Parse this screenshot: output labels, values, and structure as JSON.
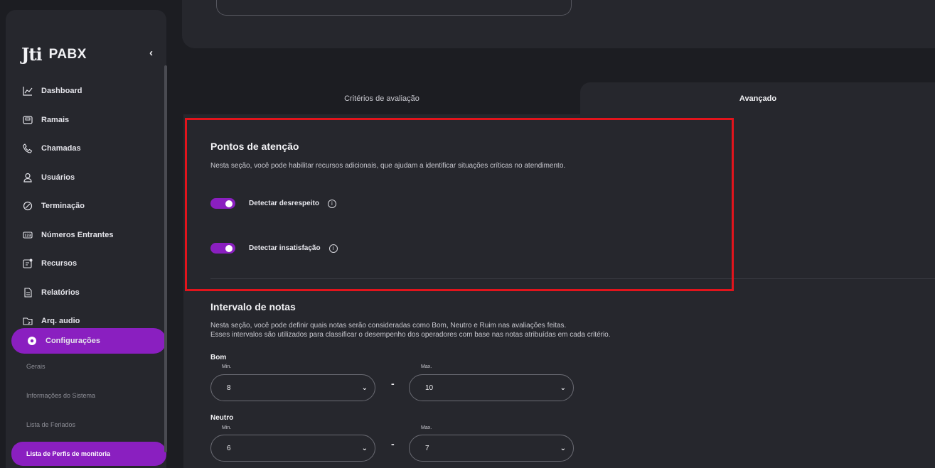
{
  "brand": {
    "logo": "Jti",
    "name": "PABX",
    "collapse_icon": "chevron-left-icon"
  },
  "sidebar": {
    "items": [
      {
        "label": "Dashboard",
        "icon": "dashboard-icon"
      },
      {
        "label": "Ramais",
        "icon": "extension-icon"
      },
      {
        "label": "Chamadas",
        "icon": "phone-icon"
      },
      {
        "label": "Usuários",
        "icon": "user-icon"
      },
      {
        "label": "Terminação",
        "icon": "termination-icon"
      },
      {
        "label": "Números Entrantes",
        "icon": "numbers-icon"
      },
      {
        "label": "Recursos",
        "icon": "resources-icon"
      },
      {
        "label": "Relatórios",
        "icon": "report-icon"
      },
      {
        "label": "Arq. audio",
        "icon": "audio-file-icon"
      }
    ],
    "active": {
      "label": "Configurações",
      "icon": "gear-icon"
    },
    "sub_items": [
      {
        "label": "Gerais"
      },
      {
        "label": "Informações do Sistema"
      },
      {
        "label": "Lista de Feriados"
      }
    ],
    "active_sub": {
      "label": "Lista de Perfis de monitoria"
    }
  },
  "tabs": [
    {
      "label": "Critérios de avaliação",
      "selected": false
    },
    {
      "label": "Avançado",
      "selected": true
    }
  ],
  "attention": {
    "title": "Pontos de atenção",
    "description": "Nesta seção, você pode habilitar recursos adicionais, que ajudam a identificar situações críticas no atendimento.",
    "toggles": [
      {
        "label": "Detectar desrespeito",
        "enabled": true
      },
      {
        "label": "Detectar insatisfação",
        "enabled": true
      }
    ]
  },
  "intervals": {
    "title": "Intervalo de notas",
    "description_1": "Nesta seção, você pode definir quais notas serão consideradas como Bom, Neutro e Ruim nas avaliações feitas.",
    "description_2": "Esses intervalos são utilizados para classificar o desempenho dos operadores com base nas notas atribuídas em cada critério.",
    "min_label": "Min.",
    "max_label": "Max.",
    "separator": "-",
    "groups": [
      {
        "label": "Bom",
        "min": "8",
        "max": "10"
      },
      {
        "label": "Neutro",
        "min": "6",
        "max": "7"
      }
    ]
  },
  "colors": {
    "accent": "#8a1fc0",
    "highlight_box": "#e2141c",
    "background": "#1c1d22",
    "panel": "#26272d"
  }
}
